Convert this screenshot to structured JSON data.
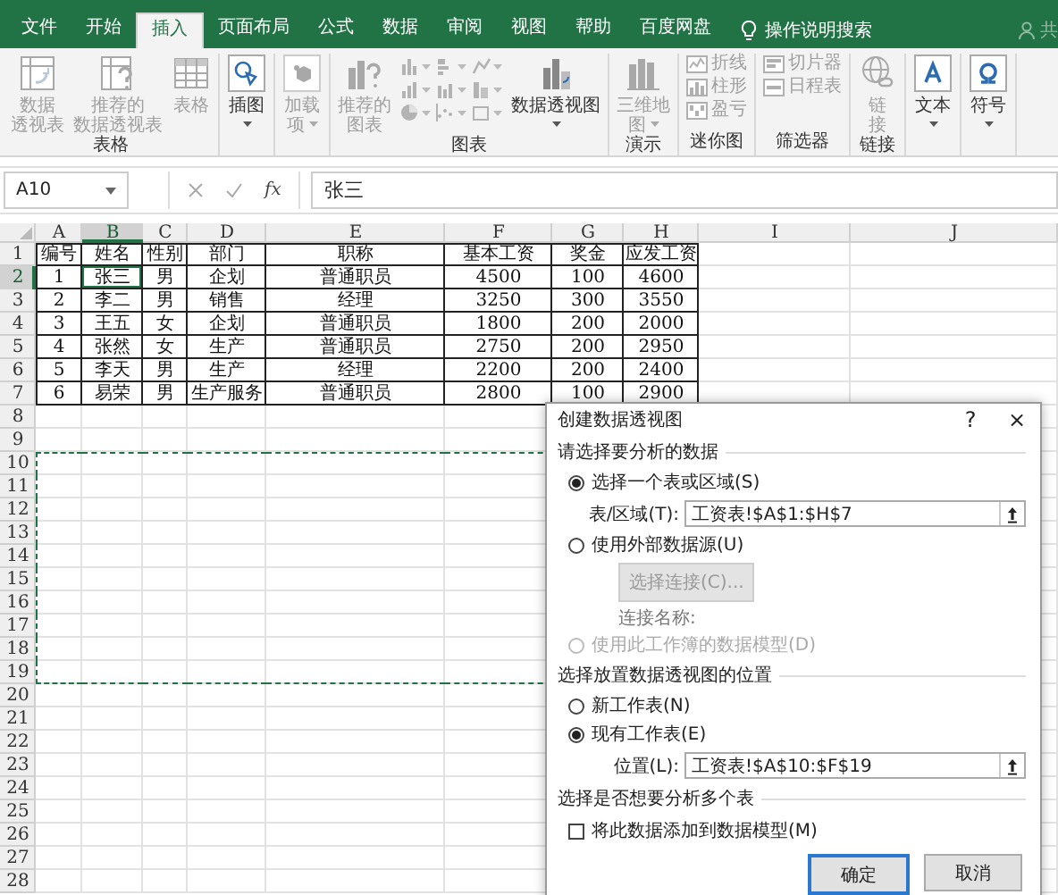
{
  "tabs": [
    {
      "label": "文件",
      "selected": false
    },
    {
      "label": "开始",
      "selected": false
    },
    {
      "label": "插入",
      "selected": true
    },
    {
      "label": "页面布局",
      "selected": false
    },
    {
      "label": "公式",
      "selected": false
    },
    {
      "label": "数据",
      "selected": false
    },
    {
      "label": "审阅",
      "selected": false
    },
    {
      "label": "视图",
      "selected": false
    },
    {
      "label": "帮助",
      "selected": false
    },
    {
      "label": "百度网盘",
      "selected": false
    }
  ],
  "tell_me": "操作说明搜索",
  "share": "共",
  "ribbon": [
    {
      "label": "表格",
      "buttons": [
        {
          "kind": "large",
          "lines": [
            "数据",
            "透视表"
          ],
          "disabled": true,
          "menu": false
        },
        {
          "kind": "large",
          "lines": [
            "推荐的",
            "数据透视表"
          ],
          "disabled": true,
          "menu": false
        },
        {
          "kind": "large",
          "lines": [
            "表格"
          ],
          "disabled": true,
          "menu": false
        }
      ]
    },
    {
      "buttons": [
        {
          "kind": "large",
          "lines": [
            "插图"
          ],
          "disabled": false,
          "menu": true
        }
      ]
    },
    {
      "buttons": [
        {
          "kind": "large",
          "lines": [
            "加载",
            "项"
          ],
          "disabled": true,
          "menu": true
        }
      ]
    },
    {
      "label": "图表",
      "buttons": [
        {
          "kind": "large",
          "lines": [
            "推荐的",
            "图表"
          ],
          "disabled": true,
          "menu": false
        },
        {
          "kind": "gallery",
          "disabled": true
        },
        {
          "kind": "large",
          "lines": [
            "数据透视图"
          ],
          "disabled": false,
          "menu": true
        }
      ]
    },
    {
      "label": "演示",
      "buttons": [
        {
          "kind": "large",
          "lines": [
            "三维地",
            "图"
          ],
          "disabled": true,
          "menu": true
        }
      ]
    },
    {
      "label": "迷你图",
      "buttons": [
        {
          "kind": "small",
          "label": "折线",
          "disabled": true
        },
        {
          "kind": "small",
          "label": "柱形",
          "disabled": true
        },
        {
          "kind": "small",
          "label": "盈亏",
          "disabled": true
        }
      ]
    },
    {
      "label": "筛选器",
      "buttons": [
        {
          "kind": "small",
          "label": "切片器",
          "disabled": true
        },
        {
          "kind": "small",
          "label": "日程表",
          "disabled": true
        }
      ]
    },
    {
      "label": "链接",
      "buttons": [
        {
          "kind": "large",
          "lines": [
            "链",
            "接"
          ],
          "disabled": true,
          "menu": false
        }
      ]
    },
    {
      "buttons": [
        {
          "kind": "large",
          "lines": [
            "文本"
          ],
          "disabled": false,
          "menu": true
        }
      ]
    },
    {
      "buttons": [
        {
          "kind": "large",
          "lines": [
            "符号"
          ],
          "disabled": false,
          "menu": true
        }
      ]
    }
  ],
  "name_box": "A10",
  "function_label": "fx",
  "formula": "张三",
  "columns": [
    {
      "letter": "A",
      "selected": false,
      "marquee": true
    },
    {
      "letter": "B",
      "selected": true,
      "marquee": true
    },
    {
      "letter": "C",
      "selected": false,
      "marquee": true
    },
    {
      "letter": "D",
      "selected": false,
      "marquee": true
    },
    {
      "letter": "E",
      "selected": false,
      "marquee": true
    },
    {
      "letter": "F",
      "selected": false,
      "marquee": true
    },
    {
      "letter": "G",
      "selected": false,
      "marquee": false
    },
    {
      "letter": "H",
      "selected": false,
      "marquee": false
    },
    {
      "letter": "I",
      "selected": false,
      "marquee": false
    },
    {
      "letter": "J",
      "selected": false,
      "marquee": false
    }
  ],
  "rows": [
    {
      "number": "1",
      "selected": false,
      "marquee": false,
      "cells": [
        "编号",
        "姓名",
        "性别",
        "部门",
        "职称",
        "基本工资",
        "奖金",
        "应发工资"
      ]
    },
    {
      "number": "2",
      "selected": true,
      "marquee": false,
      "cells": [
        "1",
        "张三",
        "男",
        "企划",
        "普通职员",
        "4500",
        "100",
        "4600"
      ]
    },
    {
      "number": "3",
      "selected": false,
      "marquee": false,
      "cells": [
        "2",
        "李二",
        "男",
        "销售",
        "经理",
        "3250",
        "300",
        "3550"
      ]
    },
    {
      "number": "4",
      "selected": false,
      "marquee": false,
      "cells": [
        "3",
        "王五",
        "女",
        "企划",
        "普通职员",
        "1800",
        "200",
        "2000"
      ]
    },
    {
      "number": "5",
      "selected": false,
      "marquee": false,
      "cells": [
        "4",
        "张然",
        "女",
        "生产",
        "普通职员",
        "2750",
        "200",
        "2950"
      ]
    },
    {
      "number": "6",
      "selected": false,
      "marquee": false,
      "cells": [
        "5",
        "李天",
        "男",
        "生产",
        "经理",
        "2200",
        "200",
        "2400"
      ]
    },
    {
      "number": "7",
      "selected": false,
      "marquee": false,
      "cells": [
        "6",
        "易荣",
        "男",
        "生产服务",
        "普通职员",
        "2800",
        "100",
        "2900"
      ]
    },
    {
      "number": "8",
      "selected": false,
      "marquee": false
    },
    {
      "number": "9",
      "selected": false,
      "marquee": false
    },
    {
      "number": "10",
      "selected": false,
      "marquee": true
    },
    {
      "number": "11",
      "selected": false,
      "marquee": true
    },
    {
      "number": "12",
      "selected": false,
      "marquee": true
    },
    {
      "number": "13",
      "selected": false,
      "marquee": true
    },
    {
      "number": "14",
      "selected": false,
      "marquee": true
    },
    {
      "number": "15",
      "selected": false,
      "marquee": true
    },
    {
      "number": "16",
      "selected": false,
      "marquee": true
    },
    {
      "number": "17",
      "selected": false,
      "marquee": true
    },
    {
      "number": "18",
      "selected": false,
      "marquee": true
    },
    {
      "number": "19",
      "selected": false,
      "marquee": true
    },
    {
      "number": "20",
      "selected": false,
      "marquee": false
    },
    {
      "number": "21",
      "selected": false,
      "marquee": false
    },
    {
      "number": "22",
      "selected": false,
      "marquee": false
    },
    {
      "number": "23",
      "selected": false,
      "marquee": false
    },
    {
      "number": "24",
      "selected": false,
      "marquee": false
    },
    {
      "number": "25",
      "selected": false,
      "marquee": false
    },
    {
      "number": "26",
      "selected": false,
      "marquee": false
    },
    {
      "number": "27",
      "selected": false,
      "marquee": false
    },
    {
      "number": "28",
      "selected": false,
      "marquee": false
    }
  ],
  "dialog": {
    "title": "创建数据透视图",
    "help": "?",
    "close": "×",
    "items": [
      {
        "kind": "heading",
        "text": "请选择要分析的数据"
      },
      {
        "kind": "radio",
        "label": "选择一个表或区域(S)",
        "selected": true,
        "disabled": false
      },
      {
        "kind": "field",
        "label": "表/区域(T):",
        "value": "工资表!$A$1:$H$7"
      },
      {
        "kind": "radio",
        "label": "使用外部数据源(U)",
        "selected": false,
        "disabled": false
      },
      {
        "kind": "button",
        "label": "选择连接(C)...",
        "disabled": true
      },
      {
        "kind": "note",
        "text": "连接名称:"
      },
      {
        "kind": "radio",
        "label": "使用此工作簿的数据模型(D)",
        "selected": false,
        "disabled": true
      },
      {
        "kind": "heading",
        "text": "选择放置数据透视图的位置"
      },
      {
        "kind": "radio",
        "label": "新工作表(N)",
        "selected": false,
        "disabled": false
      },
      {
        "kind": "radio",
        "label": "现有工作表(E)",
        "selected": true,
        "disabled": false
      },
      {
        "kind": "field",
        "label": "位置(L):",
        "value": "工资表!$A$10:$F$19"
      },
      {
        "kind": "heading",
        "text": "选择是否想要分析多个表"
      },
      {
        "kind": "checkbox",
        "label": "将此数据添加到数据模型(M)",
        "checked": false
      }
    ],
    "buttons": [
      {
        "label": "确定",
        "default": true
      },
      {
        "label": "取消",
        "default": false
      }
    ]
  }
}
